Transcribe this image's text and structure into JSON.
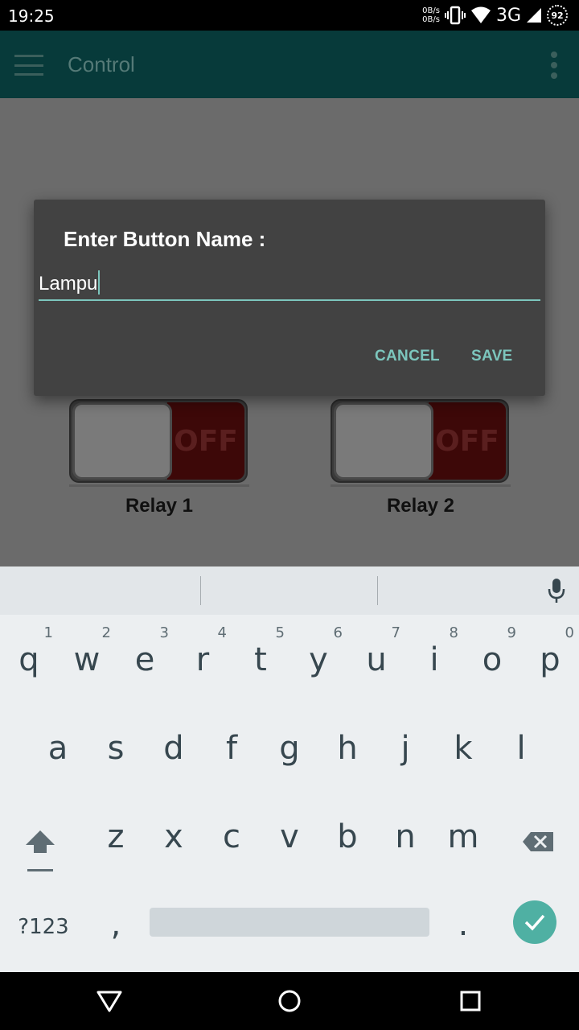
{
  "status_bar": {
    "time": "19:25",
    "net_up": "0B/s",
    "net_down": "0B/s",
    "network_type": "3G",
    "battery": "92"
  },
  "app_bar": {
    "title": "Control",
    "menu_icon": "hamburger-menu-icon",
    "overflow_icon": "more-vert-icon"
  },
  "relays": [
    {
      "label": "Relay 1",
      "state": "OFF"
    },
    {
      "label": "Relay 2",
      "state": "OFF"
    }
  ],
  "dialog": {
    "title": "Enter Button Name :",
    "input_value": "Lampu",
    "cancel_label": "CANCEL",
    "save_label": "SAVE",
    "accent_color": "#7cc6bd"
  },
  "keyboard": {
    "row1": [
      {
        "char": "q",
        "num": "1"
      },
      {
        "char": "w",
        "num": "2"
      },
      {
        "char": "e",
        "num": "3"
      },
      {
        "char": "r",
        "num": "4"
      },
      {
        "char": "t",
        "num": "5"
      },
      {
        "char": "y",
        "num": "6"
      },
      {
        "char": "u",
        "num": "7"
      },
      {
        "char": "i",
        "num": "8"
      },
      {
        "char": "o",
        "num": "9"
      },
      {
        "char": "p",
        "num": "0"
      }
    ],
    "row2": [
      "a",
      "s",
      "d",
      "f",
      "g",
      "h",
      "j",
      "k",
      "l"
    ],
    "row3": [
      "z",
      "x",
      "c",
      "v",
      "b",
      "n",
      "m"
    ],
    "symbols_label": "?123",
    "comma": ",",
    "period": ".",
    "enter_color": "#4fb0a3"
  },
  "nav_bar": {
    "back_icon": "back-triangle-icon",
    "home_icon": "home-circle-icon",
    "recents_icon": "recents-square-icon"
  }
}
